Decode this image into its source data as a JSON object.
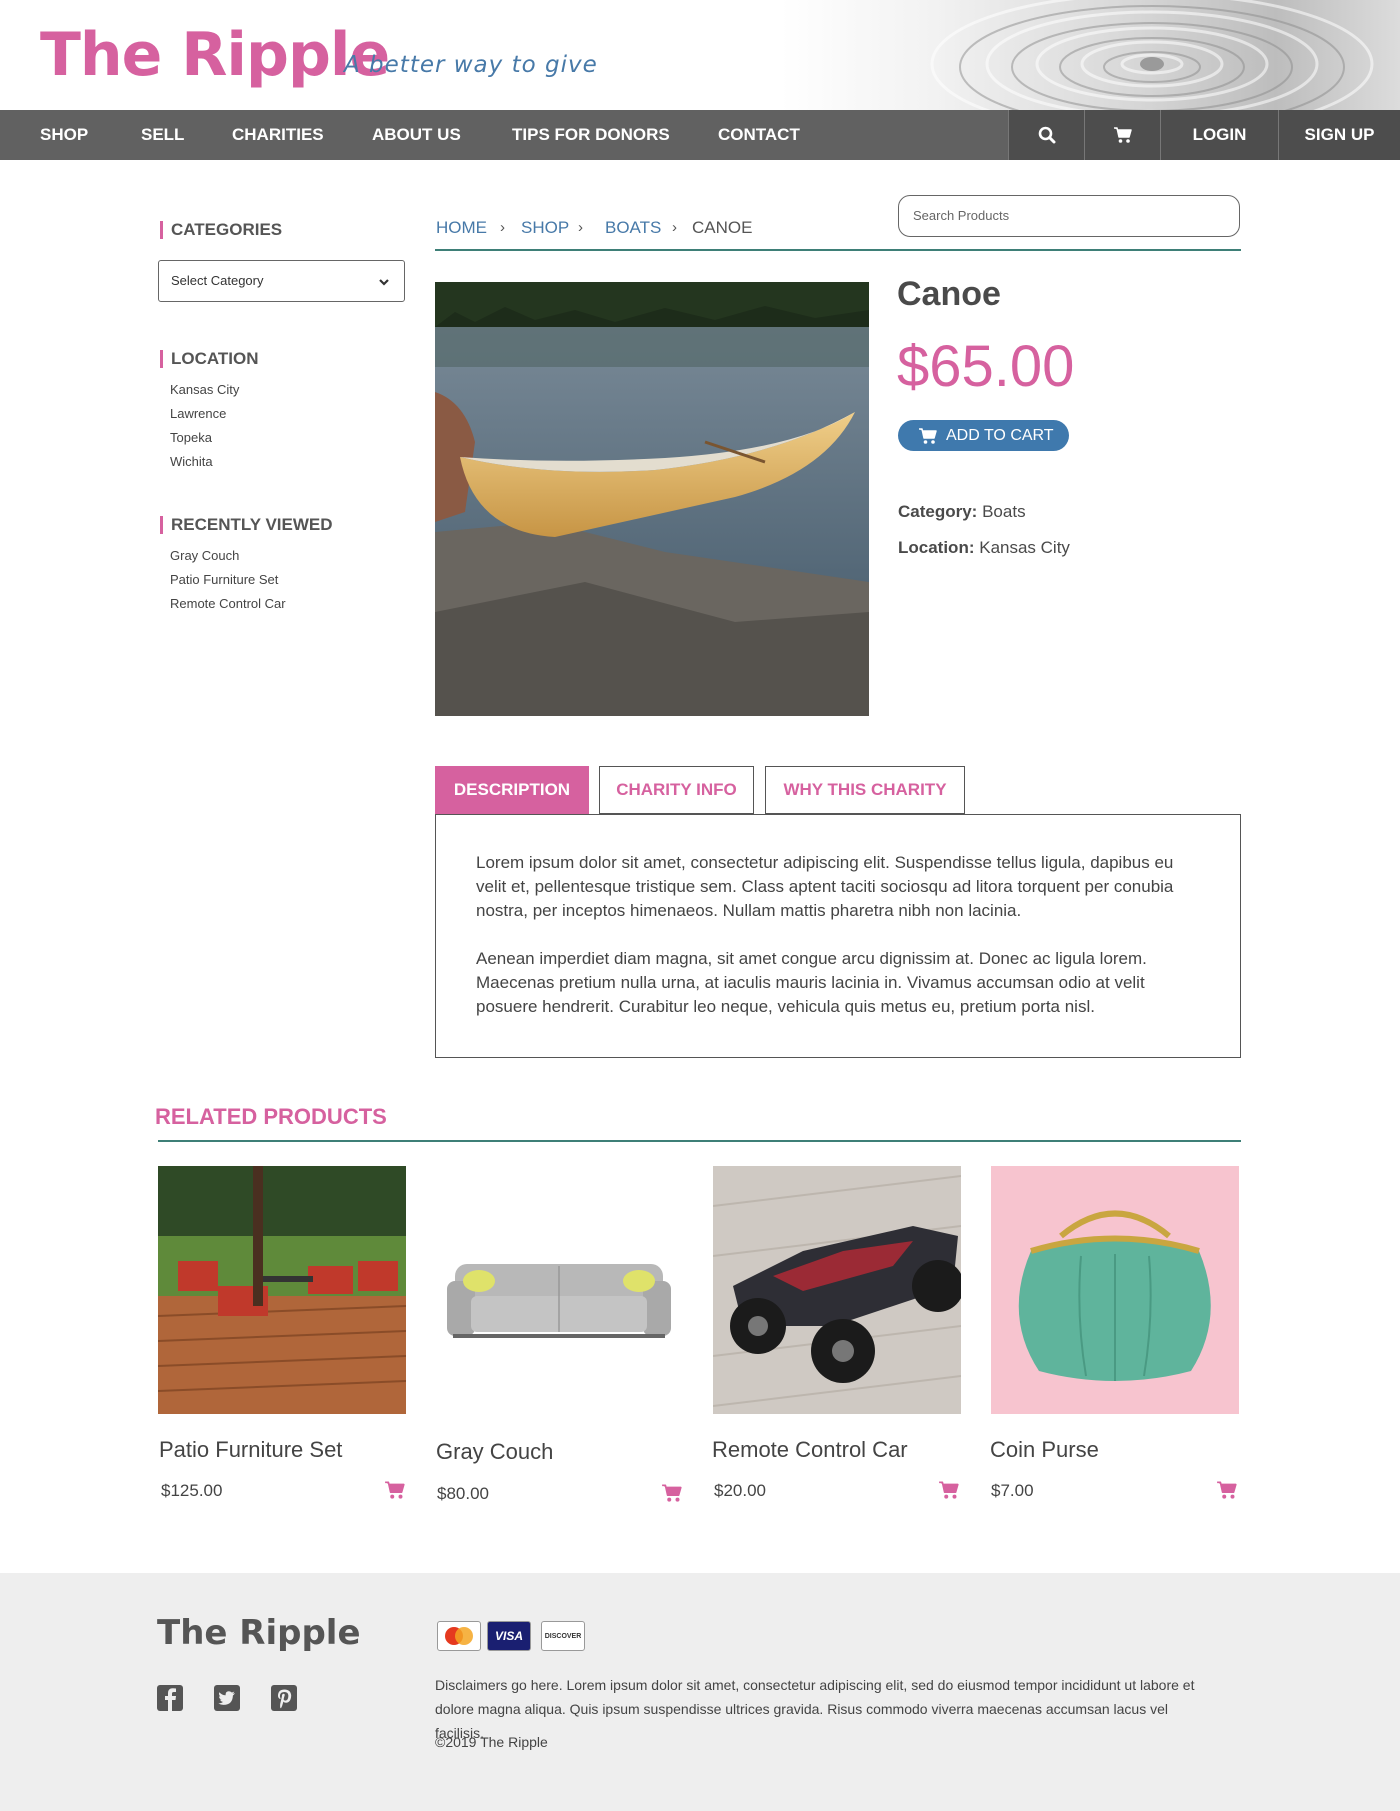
{
  "brand": {
    "name": "The Ripple",
    "tagline": "A better way to give"
  },
  "nav": {
    "items": [
      "SHOP",
      "SELL",
      "CHARITIES",
      "ABOUT US",
      "TIPS FOR DONORS",
      "CONTACT"
    ],
    "search_icon": "search-icon",
    "cart_icon": "cart-icon",
    "login": "LOGIN",
    "signup": "SIGN UP"
  },
  "sidebar": {
    "categories_heading": "CATEGORIES",
    "category_select": "Select Category",
    "location_heading": "LOCATION",
    "locations": [
      "Kansas City",
      "Lawrence",
      "Topeka",
      "Wichita"
    ],
    "recent_heading": "RECENTLY VIEWED",
    "recent": [
      "Gray Couch",
      "Patio Furniture Set",
      "Remote Control Car"
    ]
  },
  "breadcrumb": {
    "home": "HOME",
    "shop": "SHOP",
    "boats": "BOATS",
    "current": "CANOE",
    "sep": "›"
  },
  "search": {
    "placeholder": "Search Products"
  },
  "product": {
    "title": "Canoe",
    "price": "$65.00",
    "add_to_cart": "ADD TO CART",
    "category_label": "Category:",
    "category": "Boats",
    "location_label": "Location:",
    "location": "Kansas City"
  },
  "tabs": {
    "description": "DESCRIPTION",
    "charity_info": "CHARITY INFO",
    "why_this_charity": "WHY THIS CHARITY",
    "paragraph1": "Lorem ipsum dolor sit amet, consectetur adipiscing elit. Suspendisse tellus ligula, dapibus eu velit et, pellentesque tristique sem. Class aptent taciti sociosqu ad litora torquent per conubia nostra, per inceptos himenaeos. Nullam mattis pharetra nibh non lacinia.",
    "paragraph2": "Aenean imperdiet diam magna, sit amet congue arcu dignissim at. Donec ac ligula lorem. Maecenas pretium nulla urna, at iaculis mauris lacinia in. Vivamus accumsan odio at velit posuere hendrerit. Curabitur leo neque, vehicula quis metus eu, pretium porta nisl."
  },
  "related": {
    "heading": "RELATED PRODUCTS",
    "items": [
      {
        "name": "Patio Furniture Set",
        "price": "$125.00"
      },
      {
        "name": "Gray Couch",
        "price": "$80.00"
      },
      {
        "name": "Remote Control Car",
        "price": "$20.00"
      },
      {
        "name": "Coin Purse",
        "price": "$7.00"
      }
    ]
  },
  "footer": {
    "logo": "The Ripple",
    "cards": [
      "MasterCard",
      "VISA",
      "DISCOVER"
    ],
    "disclaimer": "Disclaimers go here. Lorem ipsum dolor sit amet, consectetur adipiscing elit, sed do eiusmod tempor incididunt ut labore et dolore magna aliqua. Quis ipsum suspendisse ultrices gravida. Risus commodo viverra maecenas accumsan lacus vel facilisis.",
    "copyright": "©2019 The Ripple",
    "social_icons": [
      "facebook-icon",
      "twitter-icon",
      "pinterest-icon"
    ]
  },
  "colors": {
    "accent": "#d6619f",
    "link": "#4779a8",
    "nav": "#616161",
    "rule": "#3e7f77",
    "button": "#3f79ad"
  }
}
